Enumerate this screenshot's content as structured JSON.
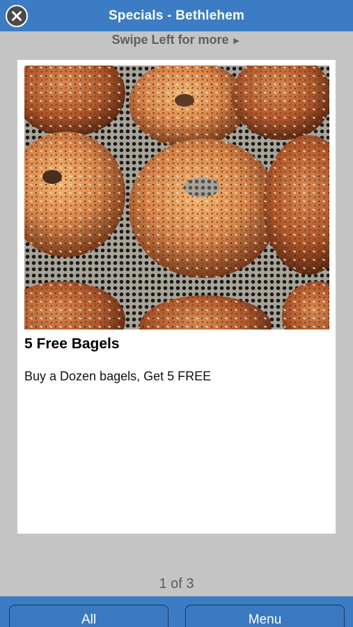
{
  "header": {
    "title": "Specials - Bethlehem",
    "close_icon": "close-icon"
  },
  "swipe_hint": {
    "text": "Swipe Left for more",
    "arrow": "►"
  },
  "special": {
    "image_subject": "bagels",
    "heading": "5 Free Bagels",
    "description": "Buy a Dozen bagels, Get 5 FREE"
  },
  "pager": {
    "text": "1 of 3"
  },
  "footer": {
    "all_label": "All",
    "menu_label": "Menu"
  },
  "colors": {
    "bar_blue": "#3b7cc4",
    "background_gray": "#c4c4c4",
    "card_white": "#ffffff"
  }
}
